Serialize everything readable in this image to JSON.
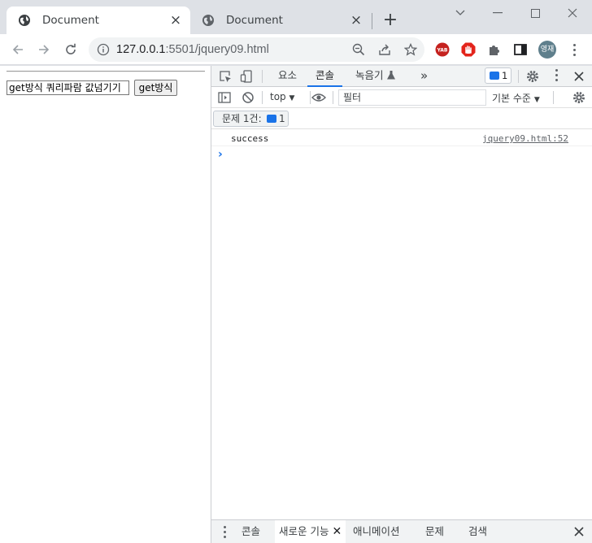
{
  "browser": {
    "tabs": [
      {
        "title": "Document",
        "active": true
      },
      {
        "title": "Document",
        "active": false
      }
    ],
    "url_host": "127.0.0.1",
    "url_rest": ":5501/jquery09.html",
    "avatar_text": "영재",
    "extensions": [
      "yab-icon",
      "adblock-hand-icon",
      "puzzle-icon",
      "sidepanel-icon"
    ]
  },
  "page": {
    "input_value": "get방식 쿼리파람 값넘기기",
    "button_label": "get방식"
  },
  "devtools": {
    "tabs": [
      "요소",
      "콘솔",
      "녹음기"
    ],
    "active_tab": "콘솔",
    "more_tabs": "»",
    "issues_badge_count": "1",
    "context": "top",
    "filter_placeholder": "필터",
    "levels_label": "기본 수준",
    "issues_label": "문제 1건:",
    "issues_count": "1",
    "logs": [
      {
        "message": "success",
        "source": "jquery09.html:52"
      }
    ],
    "prompt_symbol": "›",
    "drawer_tabs": [
      "콘솔",
      "새로운 기능",
      "애니메이션",
      "문제",
      "검색"
    ],
    "drawer_active": "새로운 기능"
  },
  "colors": {
    "accent": "#1a73e8",
    "tabstrip": "#dee1e6",
    "omnibox": "#f1f3f4"
  }
}
